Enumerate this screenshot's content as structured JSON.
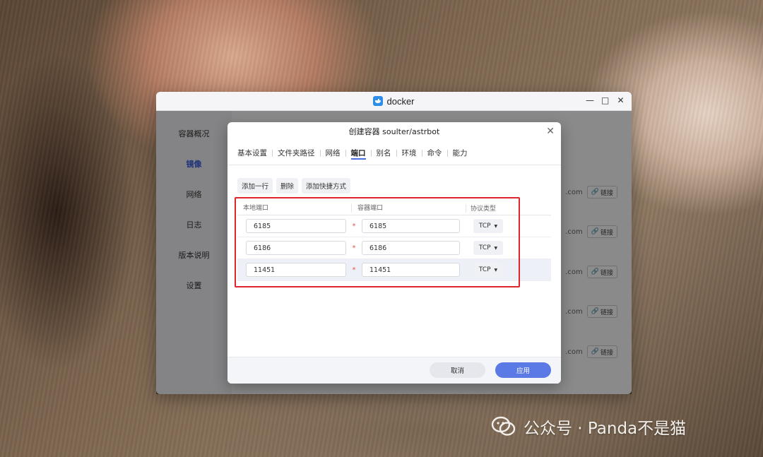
{
  "window": {
    "title": "docker"
  },
  "sidebar": {
    "items": [
      {
        "label": "容器概况"
      },
      {
        "label": "镜像"
      },
      {
        "label": "网络"
      },
      {
        "label": "日志"
      },
      {
        "label": "版本说明"
      },
      {
        "label": "设置"
      }
    ],
    "active_index": 1
  },
  "main": {
    "image_rows": [
      {
        "suffix": ".com",
        "link_label": "链接"
      },
      {
        "suffix": ".com",
        "link_label": "链接"
      },
      {
        "suffix": ".com",
        "link_label": "链接"
      },
      {
        "suffix": ".com",
        "link_label": "链接"
      },
      {
        "suffix": ".com",
        "link_label": "链接"
      }
    ]
  },
  "dialog": {
    "title": "创建容器 soulter/astrbot",
    "tabs": [
      {
        "label": "基本设置"
      },
      {
        "label": "文件夹路径"
      },
      {
        "label": "网络"
      },
      {
        "label": "端口"
      },
      {
        "label": "别名"
      },
      {
        "label": "环境"
      },
      {
        "label": "命令"
      },
      {
        "label": "能力"
      }
    ],
    "active_tab": "端口",
    "toolbar": {
      "add_row": "添加一行",
      "delete": "删除",
      "add_shortcut": "添加快捷方式"
    },
    "table": {
      "headers": {
        "local_port": "本地端口",
        "container_port": "容器端口",
        "protocol": "协议类型"
      },
      "rows": [
        {
          "local": "6185",
          "container": "6185",
          "protocol": "TCP"
        },
        {
          "local": "6186",
          "container": "6186",
          "protocol": "TCP"
        },
        {
          "local": "11451",
          "container": "11451",
          "protocol": "TCP"
        }
      ]
    },
    "footer": {
      "cancel": "取消",
      "apply": "应用"
    }
  },
  "watermark": {
    "text": "公众号 · Panda不是猫"
  },
  "colors": {
    "accent": "#5b7ae6",
    "highlight_box": "#e0242b",
    "required": "#e0534b"
  }
}
